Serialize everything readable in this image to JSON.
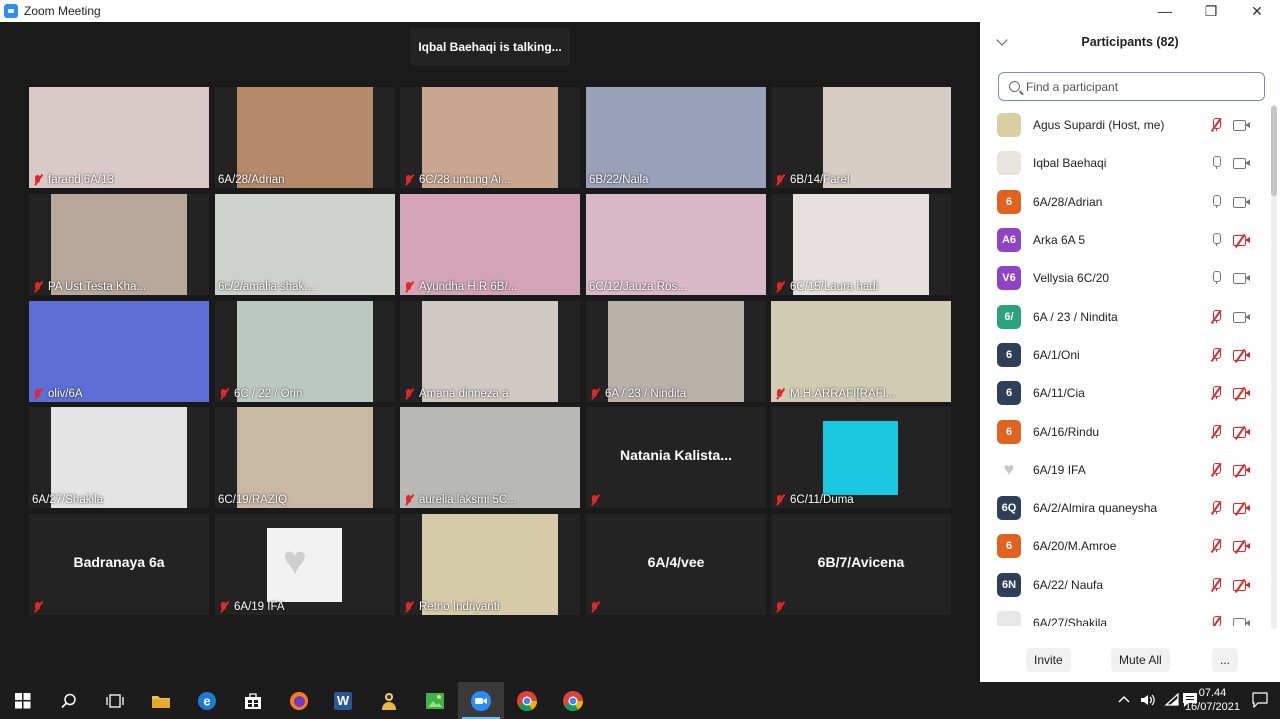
{
  "window": {
    "title": "Zoom Meeting",
    "minimize": "—",
    "restore": "❐",
    "close": "✕"
  },
  "meeting": {
    "talking": "Iqbal Baehaqi is talking..."
  },
  "tiles": [
    {
      "name": "farand 6A/13",
      "muted": true,
      "bg": "#d9c9c9"
    },
    {
      "name": "6A/28/Adrian",
      "muted": false,
      "bg": "#b48a6a"
    },
    {
      "name": "6C/28 untung Ai...",
      "muted": true,
      "bg": "#c9a68f"
    },
    {
      "name": "6B/22/Naila",
      "muted": false,
      "bg": "#9aa0b8"
    },
    {
      "name": "6B/14/Farel",
      "muted": true,
      "bg": "#d6cdc4"
    },
    {
      "name": "PA Ust Testa Kha...",
      "muted": true,
      "bg": "#b7a89a"
    },
    {
      "name": "6c/2/amalia shak...",
      "muted": false,
      "bg": "#cfd1cc"
    },
    {
      "name": "Ayundha H.R 6B/...",
      "muted": true,
      "bg": "#d2a4b5"
    },
    {
      "name": "6C/12/Jauza Ros...",
      "muted": false,
      "bg": "#d9b9c6"
    },
    {
      "name": "6C/15/Laura hadi",
      "muted": true,
      "bg": "#e6e1df"
    },
    {
      "name": "oliv/6A",
      "muted": true,
      "bg": "#5d6fd6"
    },
    {
      "name": "6C / 22 / Orin",
      "muted": true,
      "bg": "#bcc9c1"
    },
    {
      "name": "Amana dinneza a",
      "muted": true,
      "bg": "#cfc9c3"
    },
    {
      "name": "6A / 23 / Nindita",
      "muted": true,
      "bg": "#b9b2aa"
    },
    {
      "name": "M.H.ARRAFI[RAFI...",
      "muted": true,
      "bg": "#d0ccb4"
    },
    {
      "name": "6A/27/Shakila",
      "muted": false,
      "bg": "#e3e3e3"
    },
    {
      "name": "6C/19/RAZIQ",
      "muted": false,
      "bg": "#c8b8a4"
    },
    {
      "name": "aurelia laksmi 5C...",
      "muted": true,
      "bg": "#b8b8b6"
    },
    {
      "name": "",
      "muted": true,
      "bg": "",
      "label": "Natania  Kalista..."
    },
    {
      "name": "6C/11/Duma",
      "muted": true,
      "bg": "#19c7e0"
    },
    {
      "name": "",
      "muted": true,
      "bg": "",
      "label": "Badranaya 6a"
    },
    {
      "name": "6A/19 IFA",
      "muted": true,
      "bg": "#f2f2f2"
    },
    {
      "name": "Retno Indriyanti",
      "muted": true,
      "bg": "#d6cba8"
    },
    {
      "name": "",
      "muted": true,
      "bg": "",
      "label": "6A/4/vee"
    },
    {
      "name": "",
      "muted": true,
      "bg": "",
      "label": "6B/7/Avicena"
    }
  ],
  "participants": {
    "title": "Participants (82)",
    "search_placeholder": "Find a participant",
    "items": [
      {
        "name": "Agus Supardi (Host, me)",
        "avatar": "",
        "color": "#d8d0a0",
        "mic": "muted",
        "cam": "on"
      },
      {
        "name": "Iqbal Baehaqi",
        "avatar": "",
        "color": "#e8e4e0",
        "mic": "on",
        "cam": "on"
      },
      {
        "name": "6A/28/Adrian",
        "avatar": "6",
        "color": "#e0631f",
        "mic": "on",
        "cam": "on"
      },
      {
        "name": "Arka 6A 5",
        "avatar": "A6",
        "color": "#8e44c4",
        "mic": "on",
        "cam": "off"
      },
      {
        "name": "Vellysia 6C/20",
        "avatar": "V6",
        "color": "#8e44c4",
        "mic": "on",
        "cam": "on"
      },
      {
        "name": "6A / 23 / Nindita",
        "avatar": "6/",
        "color": "#2aa37a",
        "mic": "muted",
        "cam": "on"
      },
      {
        "name": "6A/1/Oni",
        "avatar": "6",
        "color": "#2e4057",
        "mic": "muted",
        "cam": "off"
      },
      {
        "name": "6A/11/Cia",
        "avatar": "6",
        "color": "#2e4057",
        "mic": "muted",
        "cam": "off"
      },
      {
        "name": "6A/16/Rindu",
        "avatar": "6",
        "color": "#e0631f",
        "mic": "muted",
        "cam": "off"
      },
      {
        "name": "6A/19 IFA",
        "avatar": "♥",
        "color": "#ffffff",
        "mic": "muted",
        "cam": "off"
      },
      {
        "name": "6A/2/Almira quaneysha",
        "avatar": "6Q",
        "color": "#2e4057",
        "mic": "muted",
        "cam": "off"
      },
      {
        "name": "6A/20/M.Amroe",
        "avatar": "6",
        "color": "#e0631f",
        "mic": "muted",
        "cam": "off"
      },
      {
        "name": "6A/22/ Naufa",
        "avatar": "6N",
        "color": "#2e4057",
        "mic": "muted",
        "cam": "off"
      },
      {
        "name": "6A/27/Shakila",
        "avatar": "",
        "color": "#e8e8e8",
        "mic": "muted",
        "cam": "on"
      }
    ],
    "invite": "Invite",
    "mute_all": "Mute All",
    "more": "..."
  },
  "taskbar": {
    "time": "07.44",
    "date": "16/07/2021",
    "word_label": "W"
  }
}
